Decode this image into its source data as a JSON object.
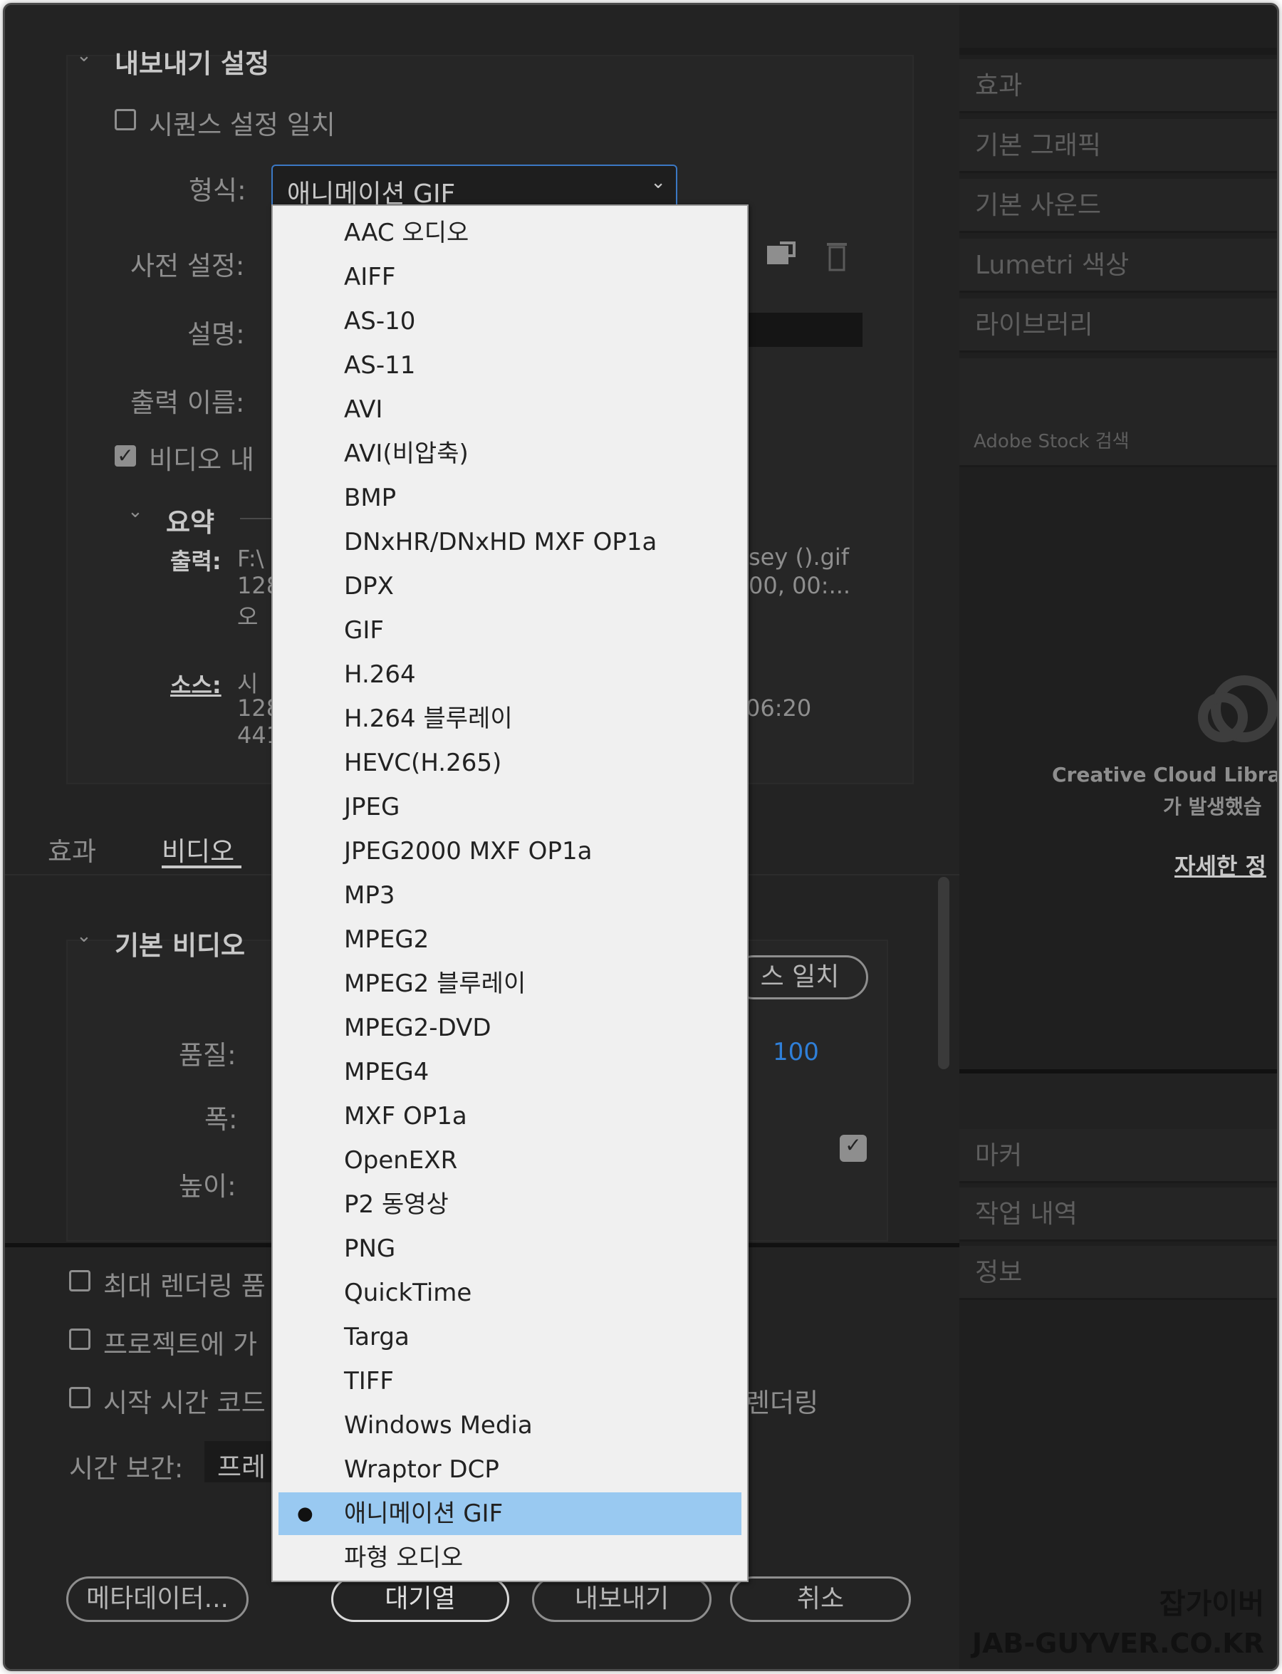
{
  "export_settings": {
    "section_title": "내보내기 설정",
    "match_sequence_label": "시퀀스 설정 일치",
    "format_label": "형식:",
    "format_value": "애니메이션 GIF",
    "preset_label": "사전 설정:",
    "description_label": "설명:",
    "output_name_label": "출력 이름:",
    "export_video_label": "비디오 내",
    "summary_title": "요약",
    "output_label": "출력:",
    "output_line1_left": "F:\\",
    "output_line1_right": "sey ().gif",
    "output_line2_left": "128",
    "output_line2_right": "00, 00:...",
    "output_line3_left": "오",
    "source_label": "소스:",
    "source_line1_left": "시",
    "source_line2_left": "128",
    "source_line2_right": "06:20",
    "source_line3_left": "441"
  },
  "tabs": {
    "effects": "효과",
    "video": "비디오"
  },
  "basic_video": {
    "title": "기본 비디오",
    "match_source_button": "스 일치",
    "quality_label": "품질:",
    "quality_value": "100",
    "width_label": "폭:",
    "height_label": "높이:"
  },
  "bottom_options": {
    "max_render_quality": "최대 렌더링 품",
    "add_to_project": "프로젝트에 가",
    "start_timecode": "시작 시간 코드",
    "render_alpha_partial": "렌더링",
    "time_interpolation_label": "시간 보간:",
    "time_interpolation_value": "프레"
  },
  "buttons": {
    "metadata": "메타데이터...",
    "queue": "대기열",
    "export": "내보내기",
    "cancel": "취소"
  },
  "right_panel": {
    "items": [
      "효과",
      "기본 그래픽",
      "기본 사운드",
      "Lumetri 색상",
      "라이브러리"
    ],
    "stock_search": "Adobe Stock 검색",
    "cc_message_line1": "Creative Cloud Libraries",
    "cc_message_line2": "가 발생했습",
    "more_info_link": "자세한 정",
    "lower_items": [
      "마커",
      "작업 내역",
      "정보"
    ]
  },
  "format_dropdown": {
    "options": [
      "AAC 오디오",
      "AIFF",
      "AS-10",
      "AS-11",
      "AVI",
      "AVI(비압축)",
      "BMP",
      "DNxHR/DNxHD MXF OP1a",
      "DPX",
      "GIF",
      "H.264",
      "H.264 블루레이",
      "HEVC(H.265)",
      "JPEG",
      "JPEG2000 MXF OP1a",
      "MP3",
      "MPEG2",
      "MPEG2 블루레이",
      "MPEG2-DVD",
      "MPEG4",
      "MXF OP1a",
      "OpenEXR",
      "P2 동영상",
      "PNG",
      "QuickTime",
      "Targa",
      "TIFF",
      "Windows Media",
      "Wraptor DCP",
      "애니메이션 GIF",
      "파형 오디오"
    ],
    "selected_index": 29
  },
  "watermark": {
    "line1": "잡가이버",
    "line2": "JAB-GUYVER.CO.KR"
  }
}
